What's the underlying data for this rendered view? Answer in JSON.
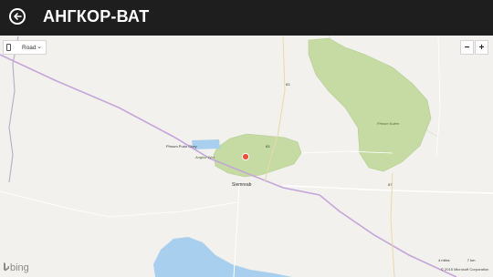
{
  "header": {
    "title": "АНГКОР-ВАТ",
    "back_icon": "arrow-left-circle-icon"
  },
  "map_controls": {
    "style_label": "Road",
    "zoom_out": "−",
    "zoom_in": "+"
  },
  "labels": {
    "phnom_krom": "Phnum Pudo Chey",
    "angkor_wat": "Angkor Wat",
    "siem_reap": "Siemreab",
    "phnom_kulen": "Phnom Kulen",
    "road_63": "63",
    "road_63b": "63",
    "road_67": "67"
  },
  "footer": {
    "brand": "bing",
    "scale_miles": "4 miles",
    "scale_km": "7 km",
    "copyright": "© 2015 Microsoft Corporation"
  },
  "colors": {
    "park_green": "#c5dba3",
    "park_border": "#a7c783",
    "water": "#a9cfee",
    "land": "#f2f1ee",
    "pin": "#e8533a"
  }
}
